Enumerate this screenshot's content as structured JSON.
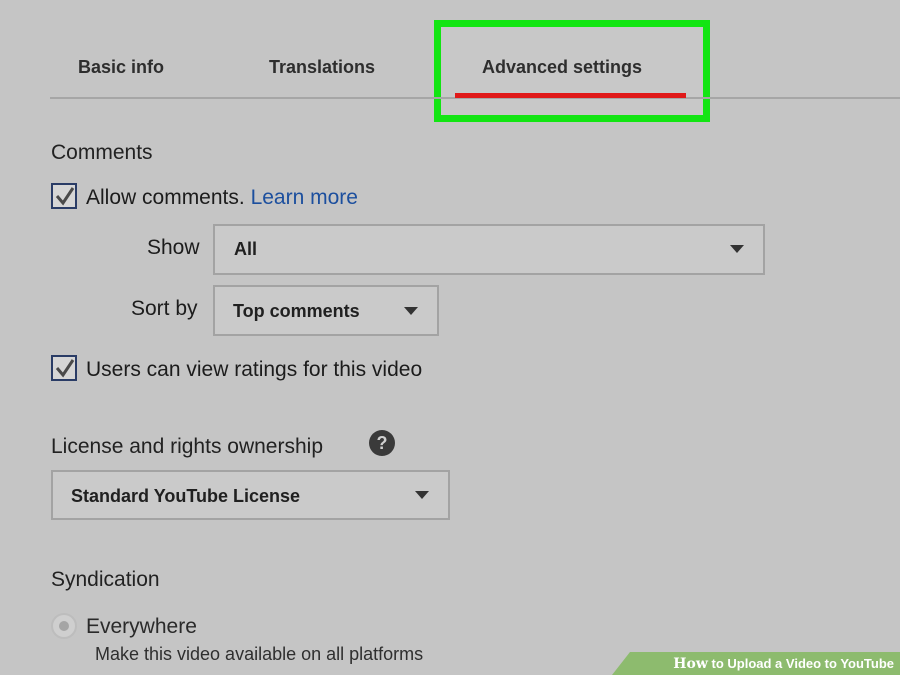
{
  "tabs": [
    {
      "label": "Basic info"
    },
    {
      "label": "Translations"
    },
    {
      "label": "Advanced settings"
    }
  ],
  "comments": {
    "title": "Comments",
    "allow_label": "Allow comments.",
    "learn_more": "Learn more",
    "allow_checked": true,
    "show_label": "Show",
    "show_value": "All",
    "sort_label": "Sort by",
    "sort_value": "Top comments",
    "ratings_label": "Users can view ratings for this video",
    "ratings_checked": true
  },
  "license": {
    "title": "License and rights ownership",
    "help_glyph": "?",
    "value": "Standard YouTube License"
  },
  "syndication": {
    "title": "Syndication",
    "option_label": "Everywhere",
    "option_desc": "Make this video available on all platforms"
  },
  "banner": {
    "how": "How",
    "text": "to Upload a Video to YouTube"
  },
  "colors": {
    "highlight": "#13e513",
    "active_tab_underline": "#e01919",
    "link": "#1c4f9e",
    "banner": "#8dbb6e"
  }
}
